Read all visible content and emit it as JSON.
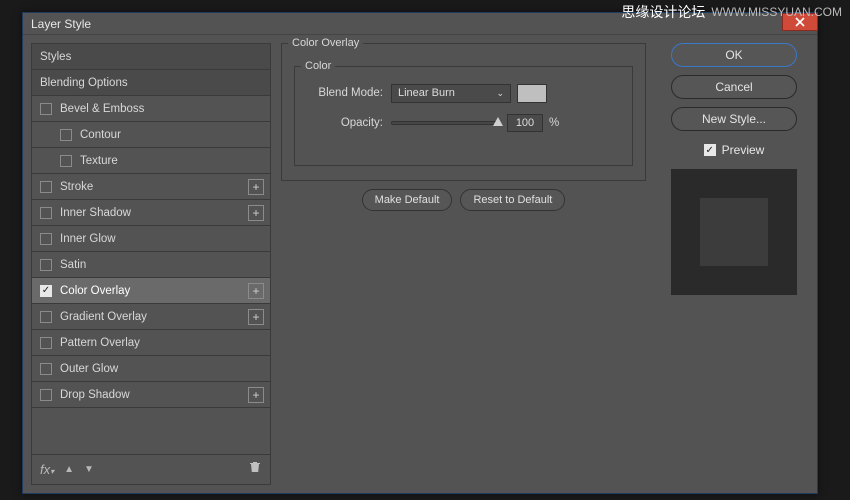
{
  "watermark": {
    "cn": "思缘设计论坛",
    "url": "WWW.MISSYUAN.COM"
  },
  "dialog": {
    "title": "Layer Style"
  },
  "effects": {
    "header_styles": "Styles",
    "header_blending": "Blending Options",
    "items": [
      {
        "label": "Bevel & Emboss",
        "checked": false,
        "plus": false,
        "indent": false
      },
      {
        "label": "Contour",
        "checked": false,
        "plus": false,
        "indent": true
      },
      {
        "label": "Texture",
        "checked": false,
        "plus": false,
        "indent": true
      },
      {
        "label": "Stroke",
        "checked": false,
        "plus": true,
        "indent": false
      },
      {
        "label": "Inner Shadow",
        "checked": false,
        "plus": true,
        "indent": false
      },
      {
        "label": "Inner Glow",
        "checked": false,
        "plus": false,
        "indent": false
      },
      {
        "label": "Satin",
        "checked": false,
        "plus": false,
        "indent": false
      },
      {
        "label": "Color Overlay",
        "checked": true,
        "plus": true,
        "indent": false,
        "selected": true
      },
      {
        "label": "Gradient Overlay",
        "checked": false,
        "plus": true,
        "indent": false
      },
      {
        "label": "Pattern Overlay",
        "checked": false,
        "plus": false,
        "indent": false
      },
      {
        "label": "Outer Glow",
        "checked": false,
        "plus": false,
        "indent": false
      },
      {
        "label": "Drop Shadow",
        "checked": false,
        "plus": true,
        "indent": false
      }
    ]
  },
  "settings": {
    "group_title": "Color Overlay",
    "subgroup_title": "Color",
    "blend_mode_label": "Blend Mode:",
    "blend_mode_value": "Linear Burn",
    "swatch_color": "#bfbfbf",
    "opacity_label": "Opacity:",
    "opacity_value": "100",
    "opacity_unit": "%",
    "make_default": "Make Default",
    "reset_default": "Reset to Default"
  },
  "right": {
    "ok": "OK",
    "cancel": "Cancel",
    "new_style": "New Style...",
    "preview": "Preview"
  }
}
